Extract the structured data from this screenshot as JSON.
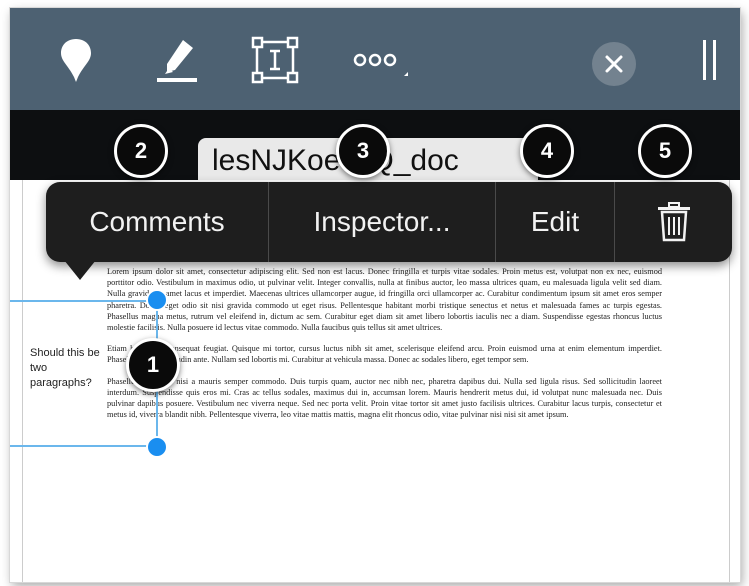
{
  "window": {
    "filename": "lesNJKoetNQ_doc"
  },
  "toolbar": {
    "icons": [
      "pin-icon",
      "highlighter-icon",
      "text-box-icon",
      "more-icon",
      "close-icon",
      "split-view-icon"
    ]
  },
  "context_menu": {
    "items": [
      "Comments",
      "Inspector...",
      "Edit"
    ],
    "delete_icon": "trash-icon"
  },
  "callouts": [
    "1",
    "2",
    "3",
    "4",
    "5"
  ],
  "comment": {
    "text": "Should this be two paragraphs?"
  },
  "document": {
    "paragraphs": [
      "Lorem ipsum dolor sit amet, consectetur adipiscing elit. Sed non est lacus. Donec fringilla et turpis vitae sodales. Proin metus est, volutpat non ex nec, euismod porttitor odio. Vestibulum in maximus odio, ut pulvinar velit. Integer convallis, nulla at finibus auctor, leo massa ultrices quam, eu malesuada ligula velit sed diam. Nulla gravida sit amet lacus et imperdiet. Maecenas ultrices ullamcorper augue, id fringilla orci ullamcorper ac. Curabitur condimentum ipsum sit amet eros semper pharetra. Donec eget odio sit nisi gravida commodo ut eget risus. Pellentesque habitant morbi tristique senectus et netus et malesuada fames ac turpis egestas. Phasellus magna metus, rutrum vel eleifend in, dictum ac sem. Curabitur eget diam sit amet libero lobortis iaculis nec a diam. Suspendisse egestas rhoncus luctus molestie facilisis. Nulla posuere id lectus vitae commodo. Nulla faucibus quis tellus sit amet ultrices.",
      "Etiam bibendum consequat feugiat. Quisque mi tortor, cursus luctus nibh sit amet, scelerisque eleifend arcu. Proin euismod urna at enim elementum imperdiet. Phasellus nec sollicitudin ante. Nullam sed lobortis mi. Curabitur at vehicula massa. Donec ac sodales libero, eget tempor sem.",
      "Phasellus venenatis nisi a mauris semper commodo. Duis turpis quam, auctor nec nibh nec, pharetra dapibus dui. Nulla sed ligula risus. Sed sollicitudin laoreet interdum. Suspendisse quis eros mi. Cras ac tellus sodales, maximus dui in, accumsan lorem. Mauris hendrerit metus dui, id volutpat nunc malesuada nec. Duis pulvinar dapibus posuere. Vestibulum nec viverra neque. Sed nec porta velit. Proin vitae tortor sit amet justo facilisis ultrices. Curabitur lacus turpis, consectetur et metus id, viverra blandit nibh. Pellentesque viverra, leo vitae mattis mattis, magna elit rhoncus odio, vitae pulvinar nisi nisi sit amet ipsum."
    ]
  },
  "colors": {
    "toolbar": "#4d6172",
    "menu": "#1e1e1e",
    "selection": "#1a8ef0"
  }
}
